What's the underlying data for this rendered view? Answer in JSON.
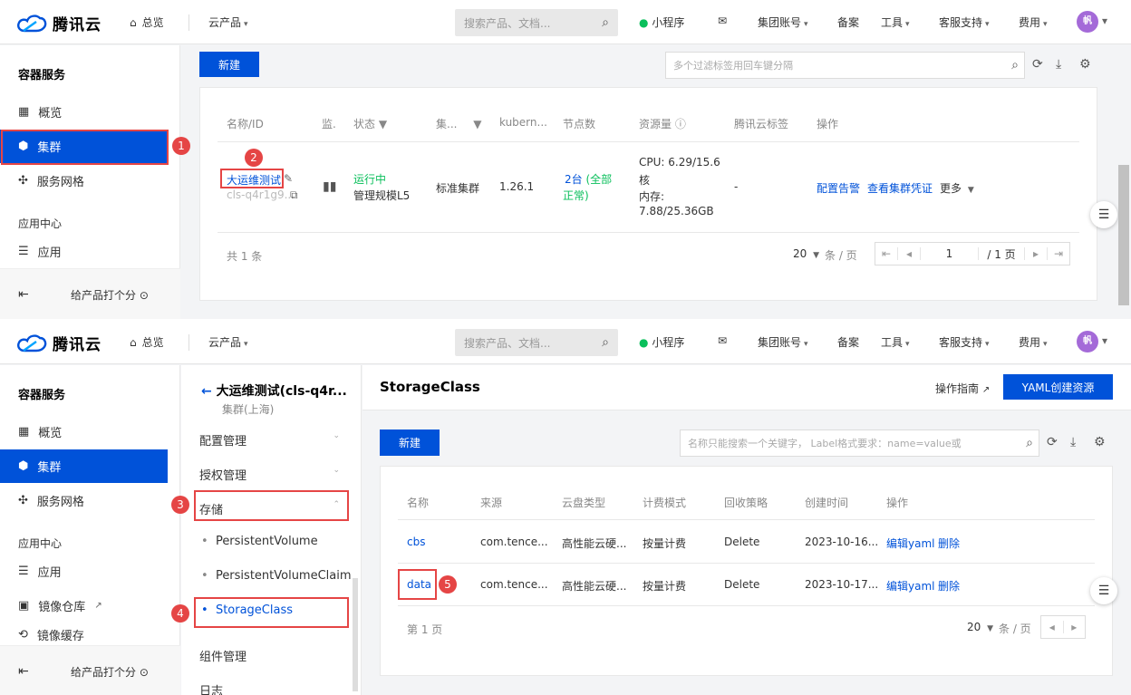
{
  "top": {
    "logo": "腾讯云",
    "home": "总览",
    "cloud_products": "云产品",
    "search_placeholder": "搜索产品、文档...",
    "mini_program": "小程序",
    "group_account": "集团账号",
    "record": "备案",
    "tools": "工具",
    "support": "客服支持",
    "fees": "费用",
    "avatar": "帆"
  },
  "sidebar": {
    "title": "容器服务",
    "overview": "概览",
    "cluster": "集群",
    "mesh": "服务网格",
    "app_center": "应用中心",
    "app": "应用",
    "image_repo": "镜像仓库",
    "image_cache": "镜像缓存",
    "rate": "给产品打个分"
  },
  "panel1": {
    "new_button": "新建",
    "filter_placeholder": "多个过滤标签用回车键分隔",
    "headers": [
      "名称/ID",
      "监.",
      "状态",
      "集...",
      "kubern...",
      "节点数",
      "资源量",
      "腾讯云标签",
      "操作"
    ],
    "row": {
      "name": "大运维测试",
      "id": "cls-q4r1g9...",
      "status": "运行中",
      "scale": "管理规模L5",
      "type": "标准集群",
      "version": "1.26.1",
      "nodes_a": "2台",
      "nodes_b": "(全部",
      "nodes_c": "正常)",
      "cpu_a": "CPU: 6.29/15.6",
      "cpu_b": "核",
      "mem_a": "内存:",
      "mem_b": "7.88/25.36GB",
      "tag": "-",
      "op_alarm": "配置告警",
      "op_cred": "查看集群凭证",
      "op_more": "更多"
    },
    "total": "共 1 条",
    "page_size": "20",
    "per_page": "条 / 页",
    "page_num": "1",
    "page_total": "/ 1 页"
  },
  "panel2": {
    "back_title": "大运维测试(cls-q4r...",
    "region": "集群(上海)",
    "menu": {
      "config": "配置管理",
      "auth": "授权管理",
      "storage": "存储",
      "pv": "PersistentVolume",
      "pvc": "PersistentVolumeClaim",
      "sc": "StorageClass",
      "components": "组件管理",
      "logs": "日志"
    },
    "page_title": "StorageClass",
    "guide": "操作指南",
    "yaml_create": "YAML创建资源",
    "new_button": "新建",
    "filter_placeholder": "名称只能搜索一个关键字， Label格式要求：name=value或",
    "headers": [
      "名称",
      "来源",
      "云盘类型",
      "计费模式",
      "回收策略",
      "创建时间",
      "操作"
    ],
    "rows": [
      {
        "name": "cbs",
        "source": "com.tence...",
        "disk": "高性能云硬...",
        "billing": "按量计费",
        "reclaim": "Delete",
        "created": "2023-10-16...",
        "edit": "编辑yaml",
        "delete": "删除"
      },
      {
        "name": "data",
        "source": "com.tence...",
        "disk": "高性能云硬...",
        "billing": "按量计费",
        "reclaim": "Delete",
        "created": "2023-10-17...",
        "edit": "编辑yaml",
        "delete": "删除"
      }
    ],
    "page_label": "第 1 页",
    "page_size": "20",
    "per_page": "条 / 页"
  },
  "callouts": [
    "1",
    "2",
    "3",
    "4",
    "5"
  ]
}
